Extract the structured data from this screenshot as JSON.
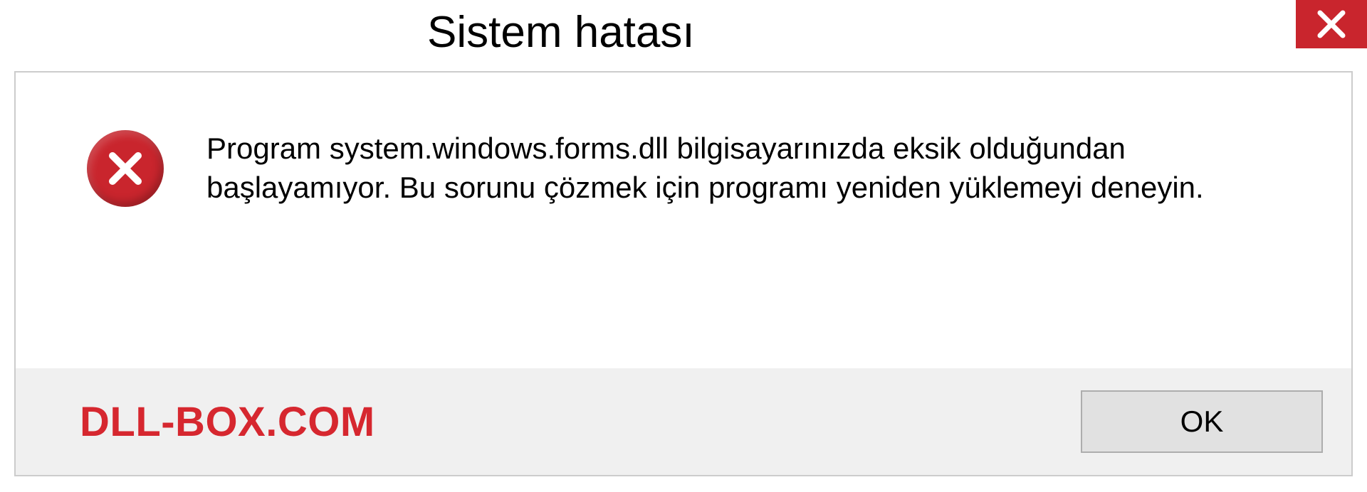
{
  "titlebar": {
    "title": "Sistem hatası"
  },
  "message": {
    "text": "Program system.windows.forms.dll bilgisayarınızda eksik olduğundan başlayamıyor. Bu sorunu çözmek için programı yeniden yüklemeyi deneyin."
  },
  "footer": {
    "watermark": "DLL-BOX.COM",
    "ok_label": "OK"
  }
}
